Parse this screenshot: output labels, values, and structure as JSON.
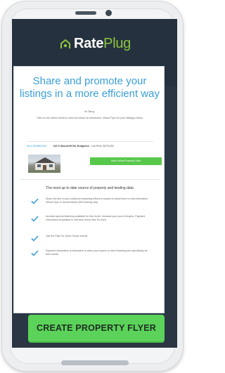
{
  "brand": {
    "name_part1": "Rate",
    "name_part2": "Plug",
    "colors": {
      "dark_header": "#26313f",
      "green": "#58c84a",
      "plug_green": "#8cc63f",
      "blue": "#3a9fd6"
    }
  },
  "email": {
    "headline": "Share and promote your listings in a more efficient way",
    "greeting": "Hi Terry,",
    "intro": "Click on the button below to view and share an interactive, Virtual Flyer for your listing(s) below",
    "listing": {
      "label": "MLS 3209857264",
      "address": "149 S Woodcliff Rd, Bridgeton",
      "price": "List Price: $275,000"
    },
    "view_button": "View Virtual Property Flyer",
    "features_title": "The most up to date source of property and lending data",
    "features": [
      {
        "text": "Share the link in your outbound marketing efforts to buyers to allow them to view interactive Virtual Flyer in Social Media (SEO friendly link)"
      },
      {
        "text": "Includes special financing available for this home. Increase your pool of buyers. Payment information is updated in real-time every time it's used."
      },
      {
        "text": "Use the Flyer for Open House events"
      },
      {
        "text": "Payment information is interactive to allow your buyers to view financing info specifically for their needs"
      }
    ]
  },
  "cta": {
    "label": "CREATE PROPERTY FLYER"
  }
}
